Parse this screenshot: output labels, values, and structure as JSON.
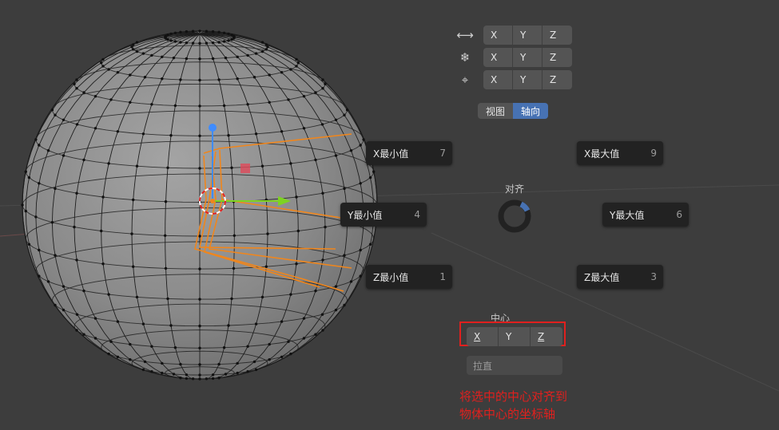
{
  "axis_rows": [
    {
      "icon": "arrows-horizontal-icon",
      "glyph": "⟷",
      "cells": [
        "X",
        "Y",
        "Z"
      ]
    },
    {
      "icon": "snowflake-icon",
      "glyph": "❄",
      "cells": [
        "X",
        "Y",
        "Z"
      ]
    },
    {
      "icon": "target-icon",
      "glyph": "⌖",
      "cells": [
        "X",
        "Y",
        "Z"
      ]
    }
  ],
  "toggle": {
    "view": "视图",
    "axis": "轴向",
    "active": "axis"
  },
  "pie": {
    "label": "对齐",
    "x_min": {
      "label": "X最小值",
      "key": "7"
    },
    "x_max": {
      "label": "X最大值",
      "key": "9"
    },
    "y_min": {
      "label": "Y最小值",
      "key": "4"
    },
    "y_max": {
      "label": "Y最大值",
      "key": "6"
    },
    "z_min": {
      "label": "Z最小值",
      "key": "1"
    },
    "z_max": {
      "label": "Z最大值",
      "key": "3"
    }
  },
  "center": {
    "label": "中心",
    "cells": [
      "X",
      "Y",
      "Z"
    ]
  },
  "straighten": {
    "label": "拉直"
  },
  "annotation": {
    "line1": "将选中的中心对齐到",
    "line2": "物体中心的坐标轴"
  },
  "colors": {
    "active": "#4772b3",
    "highlight": "#e0201e",
    "selection": "#f0861c",
    "gizmo_x": "#e04a5a",
    "gizmo_y": "#7ed321",
    "gizmo_z": "#3f8cff"
  }
}
